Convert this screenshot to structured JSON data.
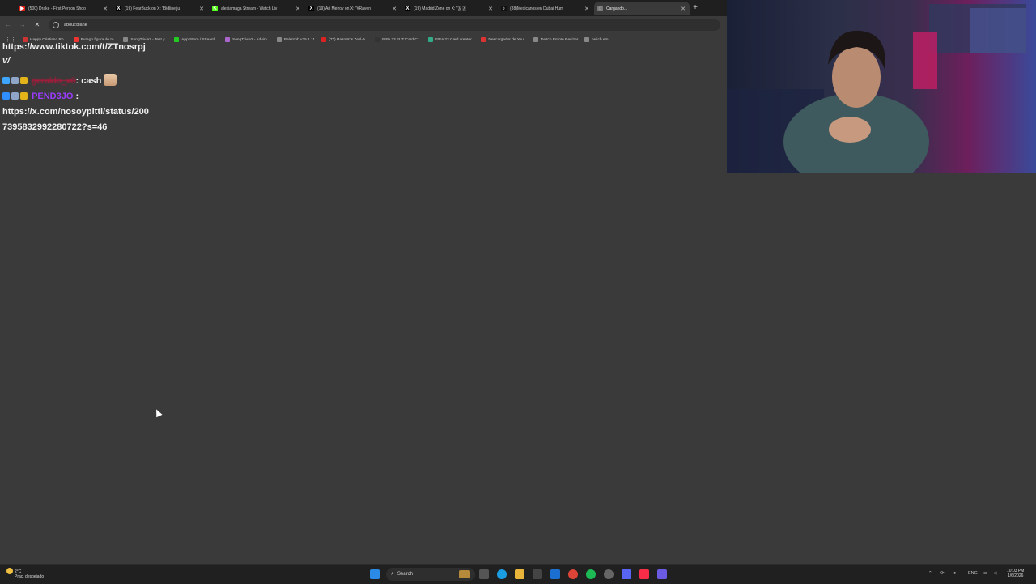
{
  "browser": {
    "tabs": [
      {
        "title": "(500) Drake - First Person Shoo",
        "color": "#e62117",
        "glyph": "▶"
      },
      {
        "title": "(19) FearBuck on X: \"Bidline ju",
        "color": "#000000",
        "glyph": "X"
      },
      {
        "title": "alexiamaga Stream - Watch Liv",
        "color": "#53fc18",
        "glyph": "K"
      },
      {
        "title": "(19) Ari Meirov on X: \"#Raven",
        "color": "#000000",
        "glyph": "X"
      },
      {
        "title": "(19) Madrid Zone on X: \"🇦 🇦",
        "color": "#000000",
        "glyph": "X"
      },
      {
        "title": "(88)Mexicanos en Dubai Hum",
        "color": "#111111",
        "glyph": "♪"
      },
      {
        "title": "Cargando...",
        "color": "#777777",
        "glyph": "◌",
        "active": true
      }
    ],
    "address": "about:blank",
    "bookmarks": [
      {
        "label": "Happy Cristiano Ro...",
        "color": "#c33"
      },
      {
        "label": "Burago figura de to...",
        "color": "#e33"
      },
      {
        "label": "SongTrivia2 - Test y...",
        "color": "#888"
      },
      {
        "label": "App Store / Streaml...",
        "color": "#2c2"
      },
      {
        "label": "SongTrivia2 - Advim...",
        "color": "#a6c"
      },
      {
        "label": "Paletoob v25.1.11",
        "color": "#888"
      },
      {
        "label": "(77) Razol97s Zesl-A...",
        "color": "#d22"
      },
      {
        "label": "FIFA 23 FUT Card Cr...",
        "color": "#333"
      },
      {
        "label": "FIFA 23 Card creator...",
        "color": "#3a8"
      },
      {
        "label": "Descargador de You...",
        "color": "#d33"
      },
      {
        "label": "Twitch Emote Resizer",
        "color": "#888"
      },
      {
        "label": "twitch em",
        "color": "#888"
      }
    ]
  },
  "chat": {
    "line0": "https://www.tiktok.com/t/ZTnosrpj",
    "line1": "v/",
    "user1": "geraldo_x0",
    "msg1": ": cash",
    "user2": "PEND3JO",
    "msg2": " :",
    "url_a": "https://x.com/nosoypitti/status/200",
    "url_b": "7395832992280722?s=46",
    "user1_color": "#c0143c",
    "user2_color": "#9b3cff"
  },
  "taskbar": {
    "weather_temp": "2°C",
    "weather_desc": "Prac. despejado",
    "search": "Search",
    "lang": "ENG",
    "time": "10:03 PM",
    "date": "1/6/2026"
  }
}
